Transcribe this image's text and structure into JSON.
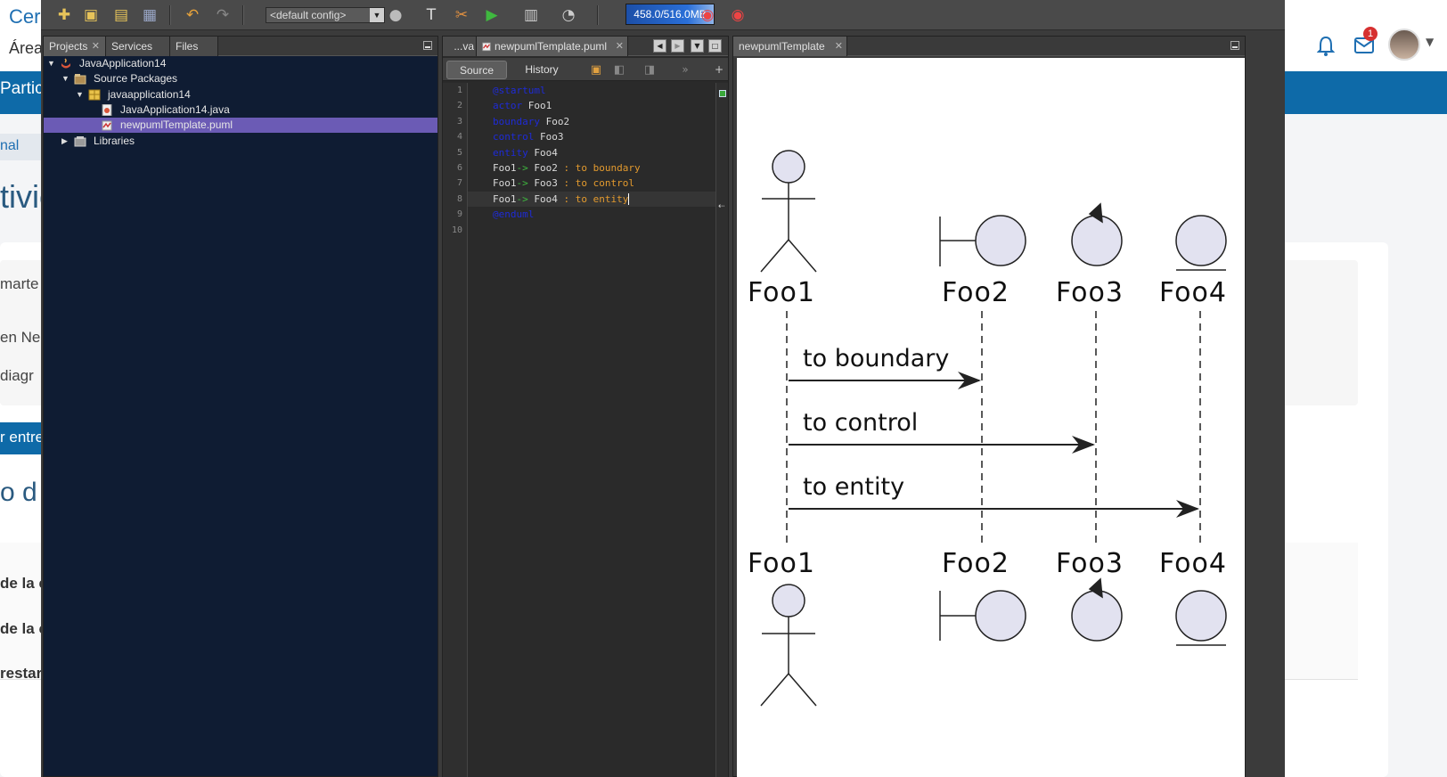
{
  "web": {
    "title": "Cer",
    "area": "Área",
    "bluebar": "Partic",
    "breadcrumb": "nal",
    "heading": "tivic",
    "card_line1": "marte",
    "card_line2": "en Ne",
    "card_line3": "diagr",
    "button": "r entre",
    "subheading": "o d",
    "rows": [
      "de la e",
      "de la c",
      "restar"
    ],
    "badge_count": "1"
  },
  "toolbar": {
    "config": "<default config>",
    "memory": "458.0/516.0MB"
  },
  "projects": {
    "tabs": [
      "Projects",
      "Services",
      "Files"
    ],
    "tree": [
      {
        "label": "JavaApplication14",
        "icon": "java-project-icon",
        "level": 0,
        "expanded": true
      },
      {
        "label": "Source Packages",
        "icon": "source-packages-icon",
        "level": 1,
        "expanded": true
      },
      {
        "label": "javaapplication14",
        "icon": "package-icon",
        "level": 2,
        "expanded": true
      },
      {
        "label": "JavaApplication14.java",
        "icon": "java-file-icon",
        "level": 3
      },
      {
        "label": "newpumlTemplate.puml",
        "icon": "puml-file-icon",
        "level": 3,
        "selected": true
      },
      {
        "label": "Libraries",
        "icon": "libraries-icon",
        "level": 1,
        "expanded": false
      }
    ]
  },
  "editor": {
    "tabs": [
      "...va",
      "newpumlTemplate.puml"
    ],
    "source_label": "Source",
    "history_label": "History",
    "line_numbers": [
      "1",
      "2",
      "3",
      "4",
      "5",
      "6",
      "7",
      "8",
      "9",
      "10"
    ],
    "lines": [
      {
        "kw": "@startuml",
        "rest": ""
      },
      {
        "kw": "actor",
        "rest": " Foo1"
      },
      {
        "kw": "boundary",
        "rest": " Foo2"
      },
      {
        "kw": "control",
        "rest": " Foo3"
      },
      {
        "kw": "entity",
        "rest": " Foo4"
      },
      {
        "from": "Foo1",
        "arrow": "->",
        "to": " Foo2 ",
        "msg": ": to boundary"
      },
      {
        "from": "Foo1",
        "arrow": "->",
        "to": " Foo3 ",
        "msg": ": to control"
      },
      {
        "from": "Foo1",
        "arrow": "->",
        "to": " Foo4 ",
        "msg": ": to entity"
      },
      {
        "kw": "@enduml",
        "rest": ""
      },
      {
        "kw": "",
        "rest": ""
      }
    ]
  },
  "preview": {
    "tab": "newpumlTemplate",
    "participants": [
      "Foo1",
      "Foo2",
      "Foo3",
      "Foo4"
    ],
    "messages": [
      "to boundary",
      "to control",
      "to entity"
    ]
  },
  "colors": {
    "participant_fill": "#e2e2f0",
    "keyword": "#1e2bd8",
    "selection": "#6b5bb5",
    "project_bg": "#0f1c33"
  }
}
